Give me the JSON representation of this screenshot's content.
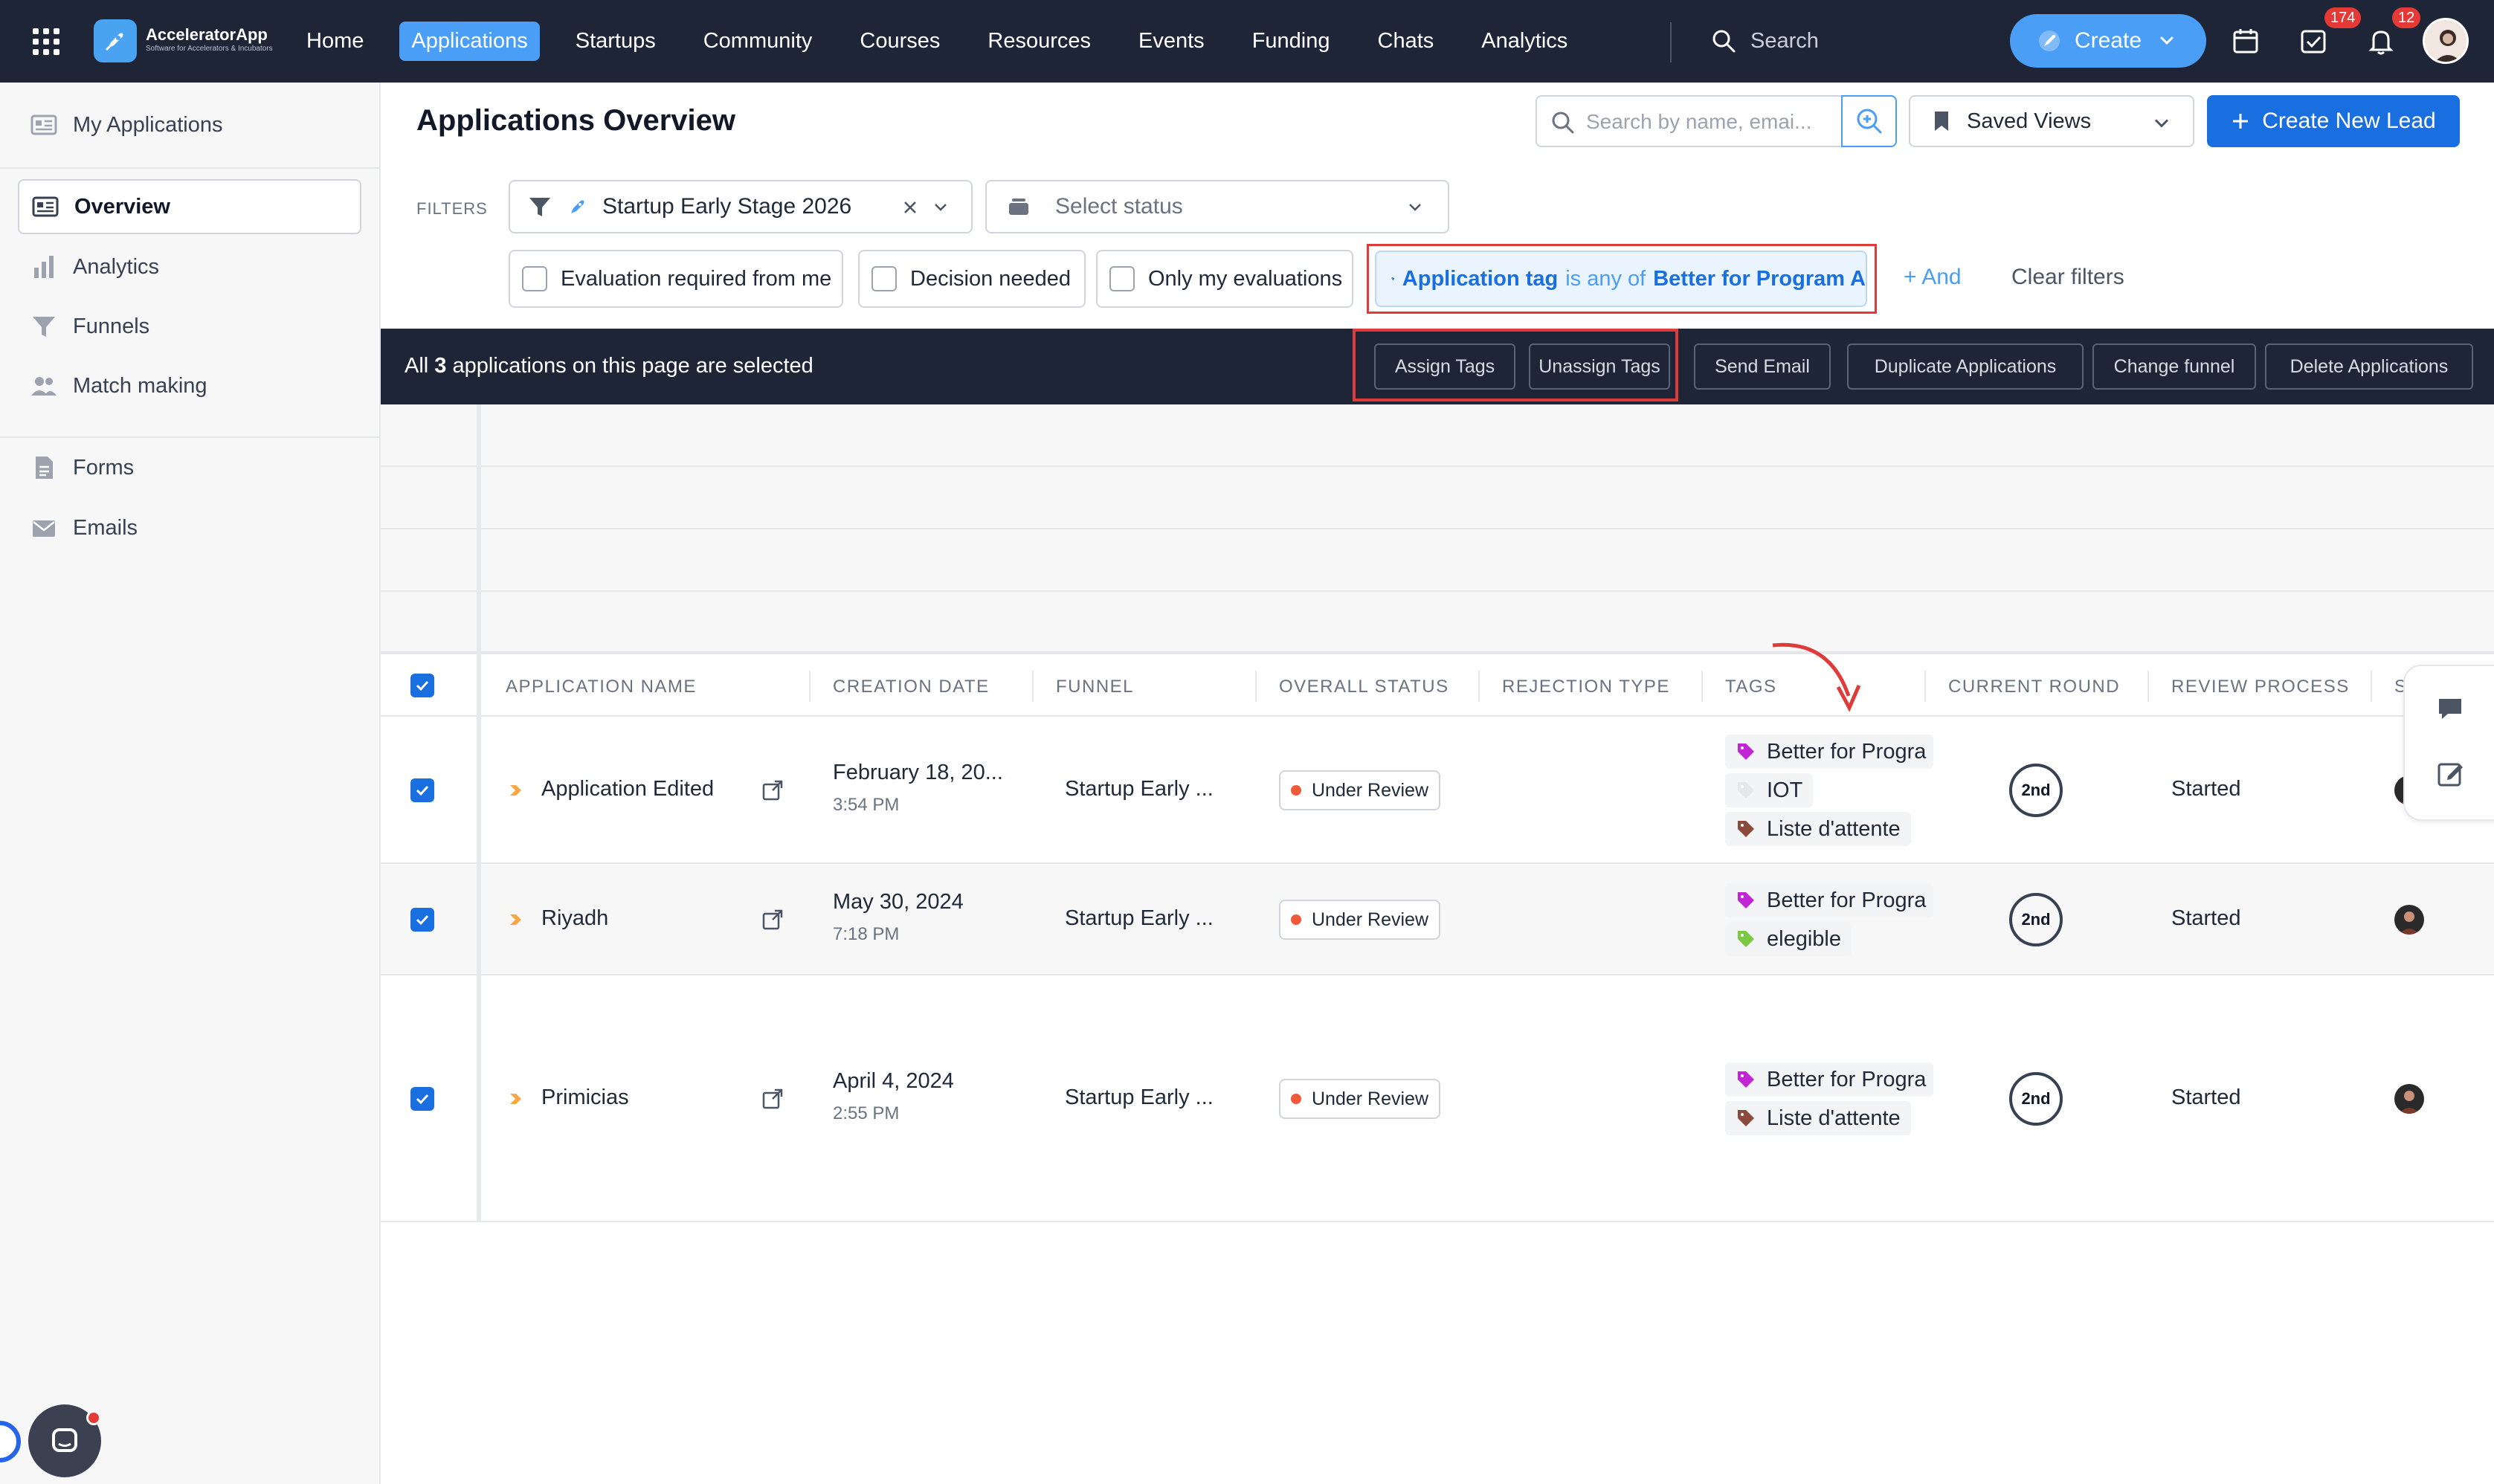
{
  "brand": {
    "name": "AcceleratorApp",
    "tagline": "Software for Accelerators & Incubators"
  },
  "nav": {
    "items": [
      "Home",
      "Applications",
      "Startups",
      "Community",
      "Courses",
      "Resources",
      "Events",
      "Funding",
      "Chats",
      "Analytics"
    ],
    "active": "Applications",
    "search_placeholder": "Search",
    "create_label": "Create",
    "tasks_badge": "174",
    "notifications_badge": "12"
  },
  "sidebar": {
    "header": "My Applications",
    "items": [
      {
        "label": "Overview",
        "icon": "overview-icon",
        "active": true
      },
      {
        "label": "Analytics",
        "icon": "bar-chart-icon"
      },
      {
        "label": "Funnels",
        "icon": "funnel-icon"
      },
      {
        "label": "Match making",
        "icon": "people-icon"
      },
      {
        "label": "Forms",
        "icon": "form-icon"
      },
      {
        "label": "Emails",
        "icon": "mail-icon"
      }
    ]
  },
  "header": {
    "title": "Applications Overview",
    "search_placeholder": "Search by name, emai...",
    "saved_views": "Saved Views",
    "new_lead": "Create New Lead"
  },
  "filters": {
    "label": "FILTERS",
    "funnel_value": "Startup Early Stage 2026",
    "status_placeholder": "Select status",
    "checkboxes": [
      "Evaluation required from me",
      "Decision needed",
      "Only my evaluations"
    ],
    "tag_filter": {
      "field": "Application tag",
      "op": "is any of",
      "value": "Better for Program A"
    },
    "and_label": "And",
    "clear_label": "Clear filters"
  },
  "selection": {
    "prefix": "All",
    "count": "3",
    "suffix": "applications on this page are selected",
    "actions": [
      "Assign Tags",
      "Unassign Tags",
      "Send Email",
      "Duplicate Applications",
      "Change funnel",
      "Delete Applications"
    ]
  },
  "table": {
    "columns": [
      "APPLICATION NAME",
      "CREATION DATE",
      "FUNNEL",
      "OVERALL STATUS",
      "REJECTION TYPE",
      "TAGS",
      "CURRENT ROUND",
      "REVIEW PROCESS",
      "S"
    ],
    "rows": [
      {
        "name": "Application Edited",
        "date": "February 18, 20...",
        "time": "3:54 PM",
        "funnel": "Startup Early ...",
        "status": "Under Review",
        "tags": [
          {
            "label": "Better for Progra",
            "color": "#c026d3"
          },
          {
            "label": "IOT",
            "color": "#e5e7eb"
          },
          {
            "label": "Liste d'attente",
            "color": "#8b4a3a"
          }
        ],
        "round": "2nd",
        "review": "Started"
      },
      {
        "name": "Riyadh",
        "date": "May 30, 2024",
        "time": "7:18 PM",
        "funnel": "Startup Early ...",
        "status": "Under Review",
        "tags": [
          {
            "label": "Better for Progra",
            "color": "#c026d3"
          },
          {
            "label": "elegible",
            "color": "#7ac943"
          }
        ],
        "round": "2nd",
        "review": "Started"
      },
      {
        "name": "Primicias",
        "date": "April 4, 2024",
        "time": "2:55 PM",
        "funnel": "Startup Early ...",
        "status": "Under Review",
        "tags": [
          {
            "label": "Better for Progra",
            "color": "#c026d3"
          },
          {
            "label": "Liste d'attente",
            "color": "#8b4a3a"
          }
        ],
        "round": "2nd",
        "review": "Started"
      }
    ]
  },
  "colors": {
    "accent": "#4a9ef5",
    "primary": "#1a6fe0",
    "dark_bar": "#1e2536",
    "highlight": "#e03b3b",
    "status_dot": "#f05a3a"
  }
}
